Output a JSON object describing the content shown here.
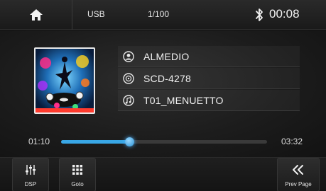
{
  "header": {
    "home_icon": "home-icon",
    "source": "USB",
    "track_count": "1/100",
    "bluetooth_icon": "bluetooth-icon",
    "time": "00:08"
  },
  "track": {
    "artist": "ALMEDIO",
    "album": "SCD-4278",
    "title": "T01_MENUETTO",
    "artist_icon": "person-icon",
    "album_icon": "disc-icon",
    "title_icon": "music-note-icon"
  },
  "playback": {
    "elapsed": "01:10",
    "total": "03:32",
    "progress_fraction": 0.33
  },
  "controls": {
    "dsp_label": "DSP",
    "dsp_icon": "equalizer-icon",
    "goto_label": "Goto",
    "goto_icon": "grid-icon",
    "prev_label": "Prev Page",
    "prev_icon": "double-chevron-left-icon"
  },
  "colors": {
    "accent": "#39a7e6",
    "background": "#1c1c1c"
  }
}
